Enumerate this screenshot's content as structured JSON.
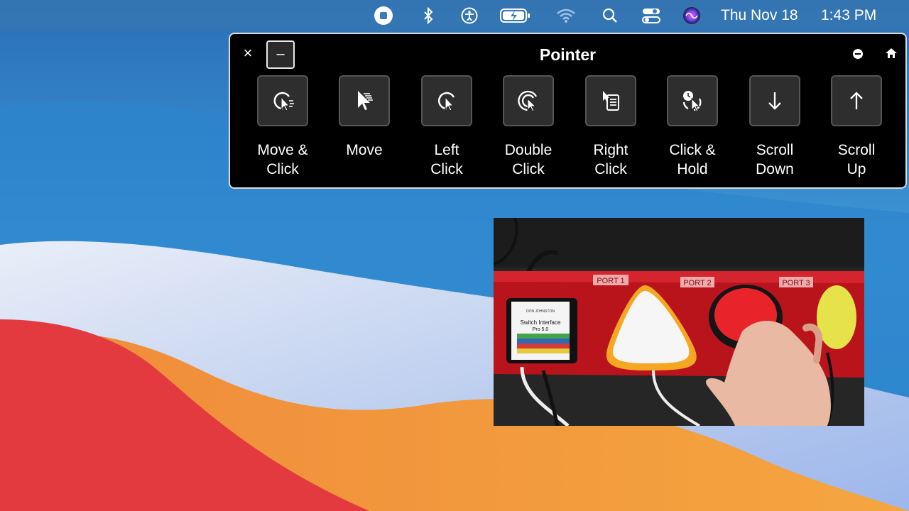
{
  "menubar": {
    "icons": [
      "screen-record-stop-icon",
      "bluetooth-icon",
      "accessibility-icon",
      "battery-charging-icon",
      "wifi-icon",
      "search-icon",
      "control-center-icon",
      "siri-icon"
    ],
    "clock_day": "Thu Nov 18",
    "clock_time": "1:43 PM"
  },
  "panel": {
    "title": "Pointer",
    "close_label": "×",
    "collapse_label": "–",
    "actions": [
      {
        "label": "Move &\nClick",
        "icon": "move-and-click-icon"
      },
      {
        "label": "Move",
        "icon": "move-pointer-icon"
      },
      {
        "label": "Left\nClick",
        "icon": "left-click-icon"
      },
      {
        "label": "Double\nClick",
        "icon": "double-click-icon"
      },
      {
        "label": "Right\nClick",
        "icon": "right-click-icon"
      },
      {
        "label": "Click &\nHold",
        "icon": "click-and-hold-icon"
      },
      {
        "label": "Scroll\nDown",
        "icon": "arrow-down-icon"
      },
      {
        "label": "Scroll\nUp",
        "icon": "arrow-up-icon"
      }
    ]
  },
  "photo": {
    "port1": "PORT 1",
    "port2": "PORT 2",
    "port3": "PORT 3",
    "device_brand": "DON JOHNSTON",
    "device_name": "Switch Interface",
    "device_model": "Pro 5.0"
  },
  "colors": {
    "panel_bg": "#000000",
    "tile_bg": "#2e2e2e",
    "wallpaper_blue": "#2f7fc4",
    "wallpaper_red": "#e23a3f",
    "wallpaper_orange": "#f19a3a",
    "switch_red": "#e8242a",
    "switch_yellow": "#e6e24a",
    "switch_orange": "#f5a623"
  }
}
